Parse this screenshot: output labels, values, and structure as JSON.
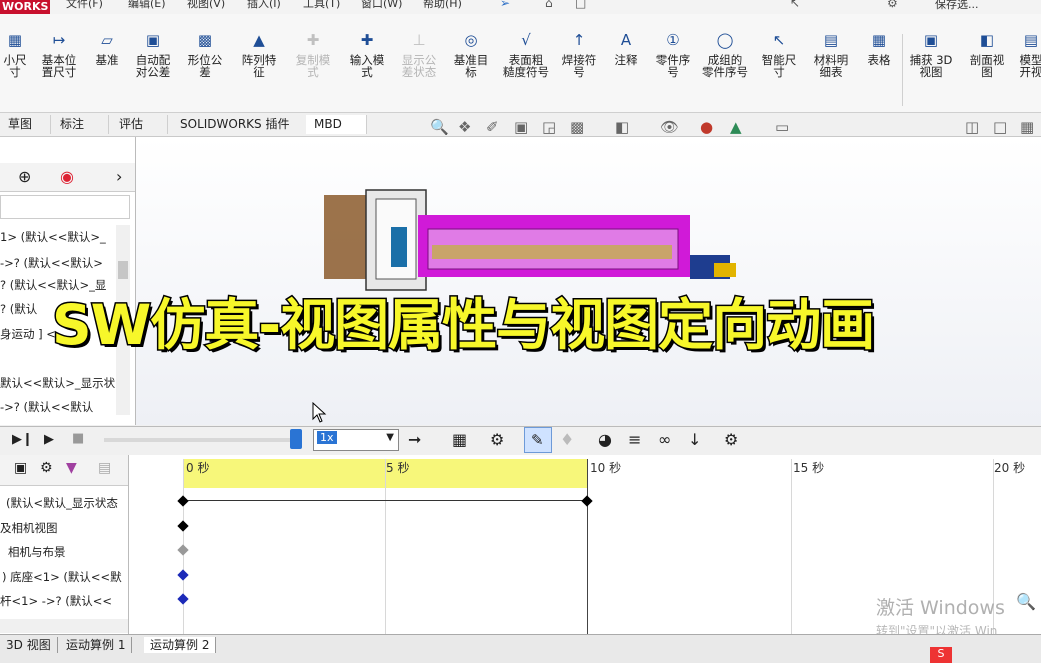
{
  "menubar": {
    "logo": "WORKS",
    "items": [
      "文件(F)",
      "编辑(E)",
      "视图(V)",
      "插入(I)",
      "工具(T)",
      "窗口(W)",
      "帮助(H)"
    ],
    "user": "保存选..."
  },
  "ribbon": {
    "buttons": [
      {
        "label1": "小尺",
        "label2": "寸",
        "icon": "small-dim-icon",
        "enabled": true
      },
      {
        "label1": "基本位",
        "label2": "置尺寸",
        "icon": "basic-position-dim-icon",
        "enabled": true
      },
      {
        "label1": "基准",
        "label2": "",
        "icon": "datum-icon",
        "enabled": true
      },
      {
        "label1": "自动配",
        "label2": "对公差",
        "icon": "auto-tolerance-icon",
        "enabled": true
      },
      {
        "label1": "形位公",
        "label2": "差",
        "icon": "geometric-tolerance-icon",
        "enabled": true
      },
      {
        "label1": "阵列特",
        "label2": "征",
        "icon": "pattern-feature-icon",
        "enabled": true
      },
      {
        "label1": "复制模",
        "label2": "式",
        "icon": "copy-scheme-icon",
        "enabled": false
      },
      {
        "label1": "输入模",
        "label2": "式",
        "icon": "input-scheme-icon",
        "enabled": true
      },
      {
        "label1": "显示公",
        "label2": "差状态",
        "icon": "show-tolerance-status-icon",
        "enabled": false
      },
      {
        "label1": "基准目",
        "label2": "标",
        "icon": "datum-target-icon",
        "enabled": true
      },
      {
        "label1": "表面粗",
        "label2": "糙度符号",
        "icon": "surface-finish-icon",
        "enabled": true
      },
      {
        "label1": "焊接符",
        "label2": "号",
        "icon": "weld-symbol-icon",
        "enabled": true
      },
      {
        "label1": "注释",
        "label2": "",
        "icon": "note-icon",
        "enabled": true
      },
      {
        "label1": "零件序",
        "label2": "号",
        "icon": "balloon-icon",
        "enabled": true
      },
      {
        "label1": "成组的",
        "label2": "零件序号",
        "icon": "stacked-balloon-icon",
        "enabled": true
      },
      {
        "label1": "智能尺",
        "label2": "寸",
        "icon": "smart-dim-icon",
        "enabled": true
      },
      {
        "label1": "材料明",
        "label2": "细表",
        "icon": "bom-icon",
        "enabled": true
      },
      {
        "label1": "表格",
        "label2": "",
        "icon": "table-icon",
        "enabled": true
      },
      {
        "label1": "捕获 3D",
        "label2": "视图",
        "icon": "capture-3d-view-icon",
        "enabled": true
      },
      {
        "label1": "剖面视",
        "label2": "图",
        "icon": "section-view-icon",
        "enabled": true
      },
      {
        "label1": "模型",
        "label2": "开视",
        "icon": "model-break-view-icon",
        "enabled": true
      }
    ]
  },
  "tabs": [
    "草图",
    "标注",
    "评估",
    "SOLIDWORKS 插件",
    "MBD"
  ],
  "tree": {
    "rows": [
      "1> (默认<<默认>_",
      "->? (默认<<默认>",
      "? (默认<<默认>_显",
      "? (默认",
      "身运动 ] <",
      "默认<<默认>_显示状",
      "->? (默认<<默认"
    ]
  },
  "banner": "SW仿真-视图属性与视图定向动画",
  "motion": {
    "speed": "1x"
  },
  "timeline": {
    "ticks": [
      "0 秒",
      "5 秒",
      "10 秒",
      "15 秒",
      "20 秒"
    ],
    "rows": [
      "(默认<默认_显示状态",
      "及相机视图",
      "相机与布景",
      ") 底座<1> (默认<<默",
      "杆<1> ->? (默认<<"
    ]
  },
  "bottom_tabs": [
    "3D 视图",
    "运动算例 1",
    "运动算例 2"
  ],
  "watermark": {
    "line1": "激活 Windows",
    "line2": "转到\"设置\"以激活 Win"
  },
  "colors": {
    "banner_fill": "#f7f72a",
    "timeline_highlight": "#f7f77a",
    "model_magenta": "#d01ad8"
  }
}
